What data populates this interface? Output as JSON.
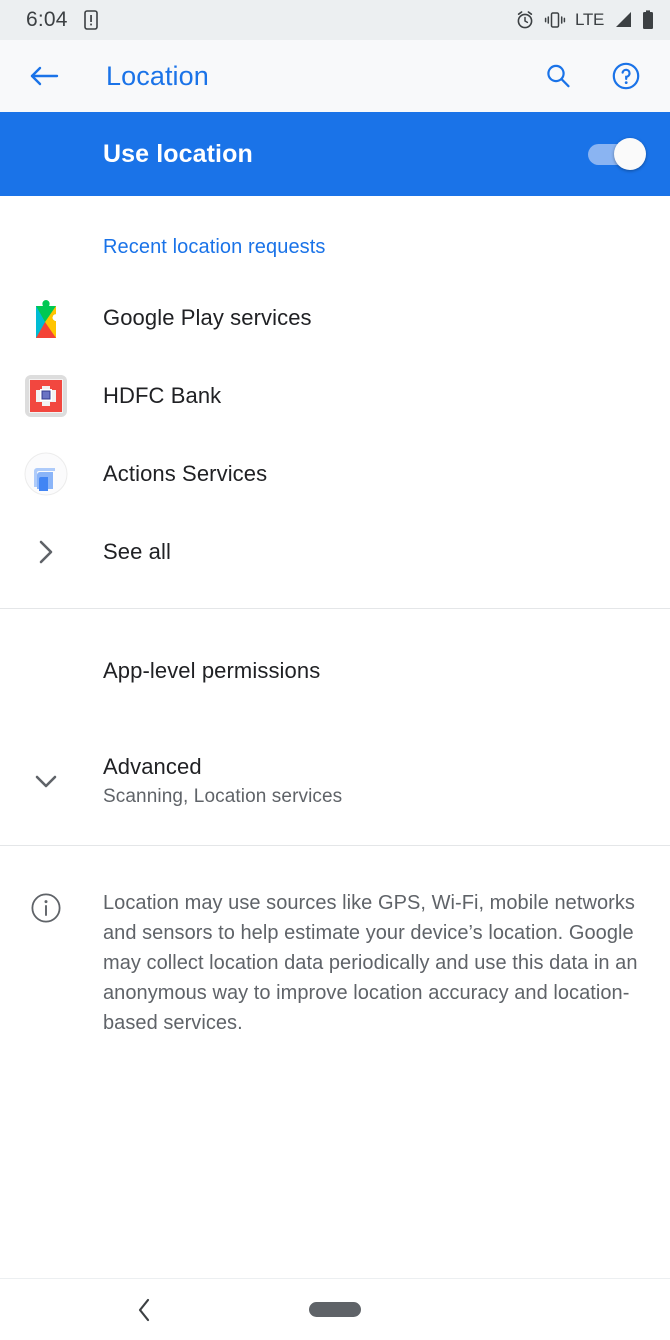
{
  "status_bar": {
    "time": "6:04",
    "left_icons": [
      "sim-card-alert-icon"
    ],
    "network_label": "LTE",
    "right_icons": [
      "alarm-icon",
      "vibrate-icon",
      "signal-icon",
      "battery-icon"
    ]
  },
  "app_bar": {
    "back_icon": "back-arrow-icon",
    "title": "Location",
    "search_icon": "search-icon",
    "help_icon": "help-circle-icon",
    "accent_color": "#1a73e8"
  },
  "master_switch": {
    "label": "Use location",
    "state": "on",
    "background_color": "#1a73e8"
  },
  "recent_requests": {
    "header": "Recent location requests",
    "items": [
      {
        "label": "Google Play services",
        "icon": "google-play-services-icon"
      },
      {
        "label": "HDFC Bank",
        "icon": "hdfc-bank-icon"
      },
      {
        "label": "Actions Services",
        "icon": "actions-services-icon"
      }
    ],
    "see_all": {
      "label": "See all",
      "icon": "chevron-right-icon"
    }
  },
  "settings": {
    "app_level_permissions": "App-level permissions",
    "advanced": {
      "title": "Advanced",
      "subtitle": "Scanning, Location services",
      "icon": "chevron-down-icon"
    }
  },
  "footer": {
    "icon": "info-icon",
    "text": "Location may use sources like GPS, Wi-Fi, mobile networks and sensors to help estimate your device’s location. Google may collect location data periodically and use this data in an anonymous way to improve location accuracy and location-based services."
  },
  "nav_bar": {
    "back_icon": "nav-back-icon",
    "home_pill": "home-pill-handle"
  }
}
